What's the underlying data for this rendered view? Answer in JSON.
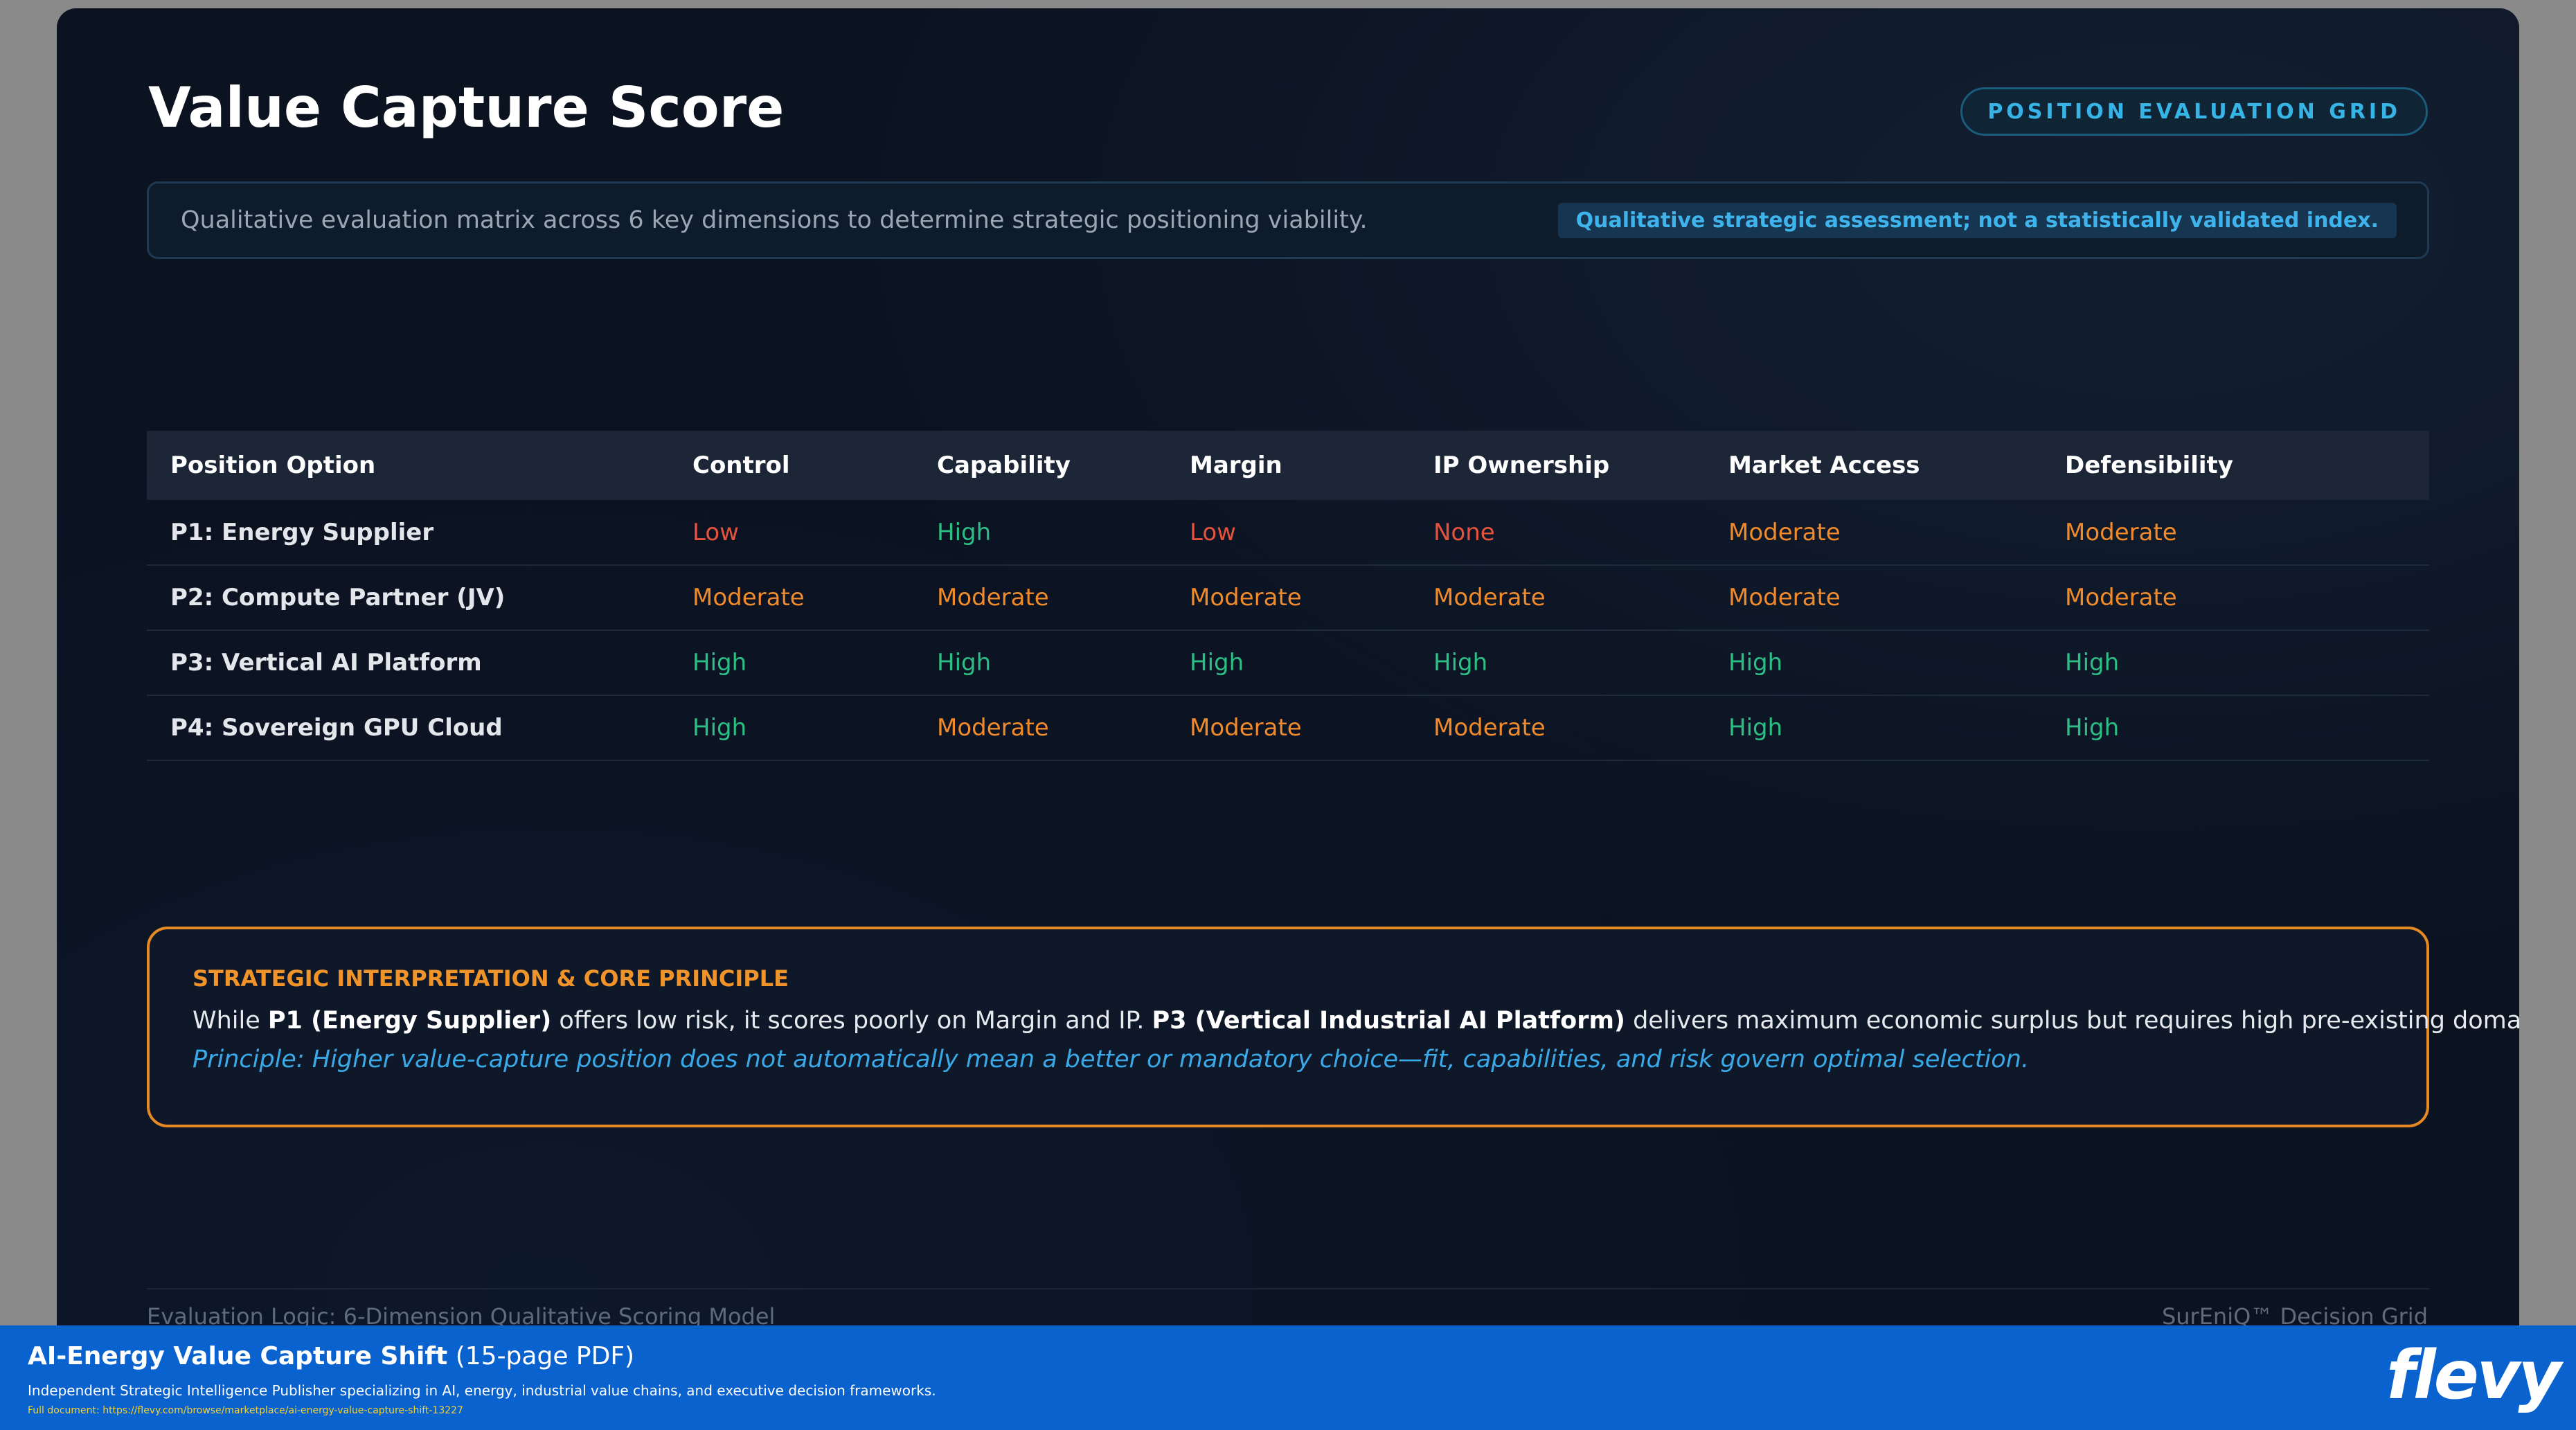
{
  "slide": {
    "title": "Value Capture Score",
    "tag": "POSITION EVALUATION GRID",
    "subtitle": "Qualitative evaluation matrix across 6 key dimensions to determine strategic positioning viability.",
    "disclaimer": "Qualitative strategic assessment; not a statistically validated index."
  },
  "table": {
    "headers": [
      "Position Option",
      "Control",
      "Capability",
      "Margin",
      "IP Ownership",
      "Market Access",
      "Defensibility"
    ],
    "rows": [
      {
        "option": "P1: Energy Supplier",
        "values": [
          "Low",
          "High",
          "Low",
          "None",
          "Moderate",
          "Moderate"
        ]
      },
      {
        "option": "P2: Compute Partner (JV)",
        "values": [
          "Moderate",
          "Moderate",
          "Moderate",
          "Moderate",
          "Moderate",
          "Moderate"
        ]
      },
      {
        "option": "P3: Vertical AI Platform",
        "values": [
          "High",
          "High",
          "High",
          "High",
          "High",
          "High"
        ]
      },
      {
        "option": "P4: Sovereign GPU Cloud",
        "values": [
          "High",
          "Moderate",
          "Moderate",
          "Moderate",
          "High",
          "High"
        ]
      }
    ],
    "level_colors": {
      "High": "#2bbf86",
      "Moderate": "#f08a2a",
      "Low": "#e55340",
      "None": "#e55340"
    }
  },
  "interpretation": {
    "heading": "STRATEGIC INTERPRETATION & CORE PRINCIPLE",
    "body_prefix": "While ",
    "p1_label": "P1 (Energy Supplier)",
    "body_mid": " offers low risk, it scores poorly on Margin and IP. ",
    "p3_label": "P3 (Vertical Industrial AI Platform)",
    "body_suffix": " delivers maximum economic surplus but requires high pre-existing domain capability.",
    "principle": "Principle: Higher value-capture position does not automatically mean a better or mandatory choice—fit, capabilities, and risk govern optimal selection."
  },
  "footer": {
    "left": "Evaluation Logic: 6-Dimension Qualitative Scoring Model",
    "right": "SurEniQ™ Decision Grid"
  },
  "banner": {
    "title": "AI-Energy Value Capture Shift",
    "pages": " (15-page PDF)",
    "description": "Independent Strategic Intelligence Publisher specializing in AI, energy, industrial value chains, and executive decision frameworks.",
    "link": "Full document: https://flevy.com/browse/marketplace/ai-energy-value-capture-shift-13227",
    "logo": "flevy"
  },
  "colors": {
    "background": "#0b1220",
    "accent_blue": "#37b4e6",
    "accent_orange": "#e78a23",
    "banner_blue": "#0a62cf"
  }
}
